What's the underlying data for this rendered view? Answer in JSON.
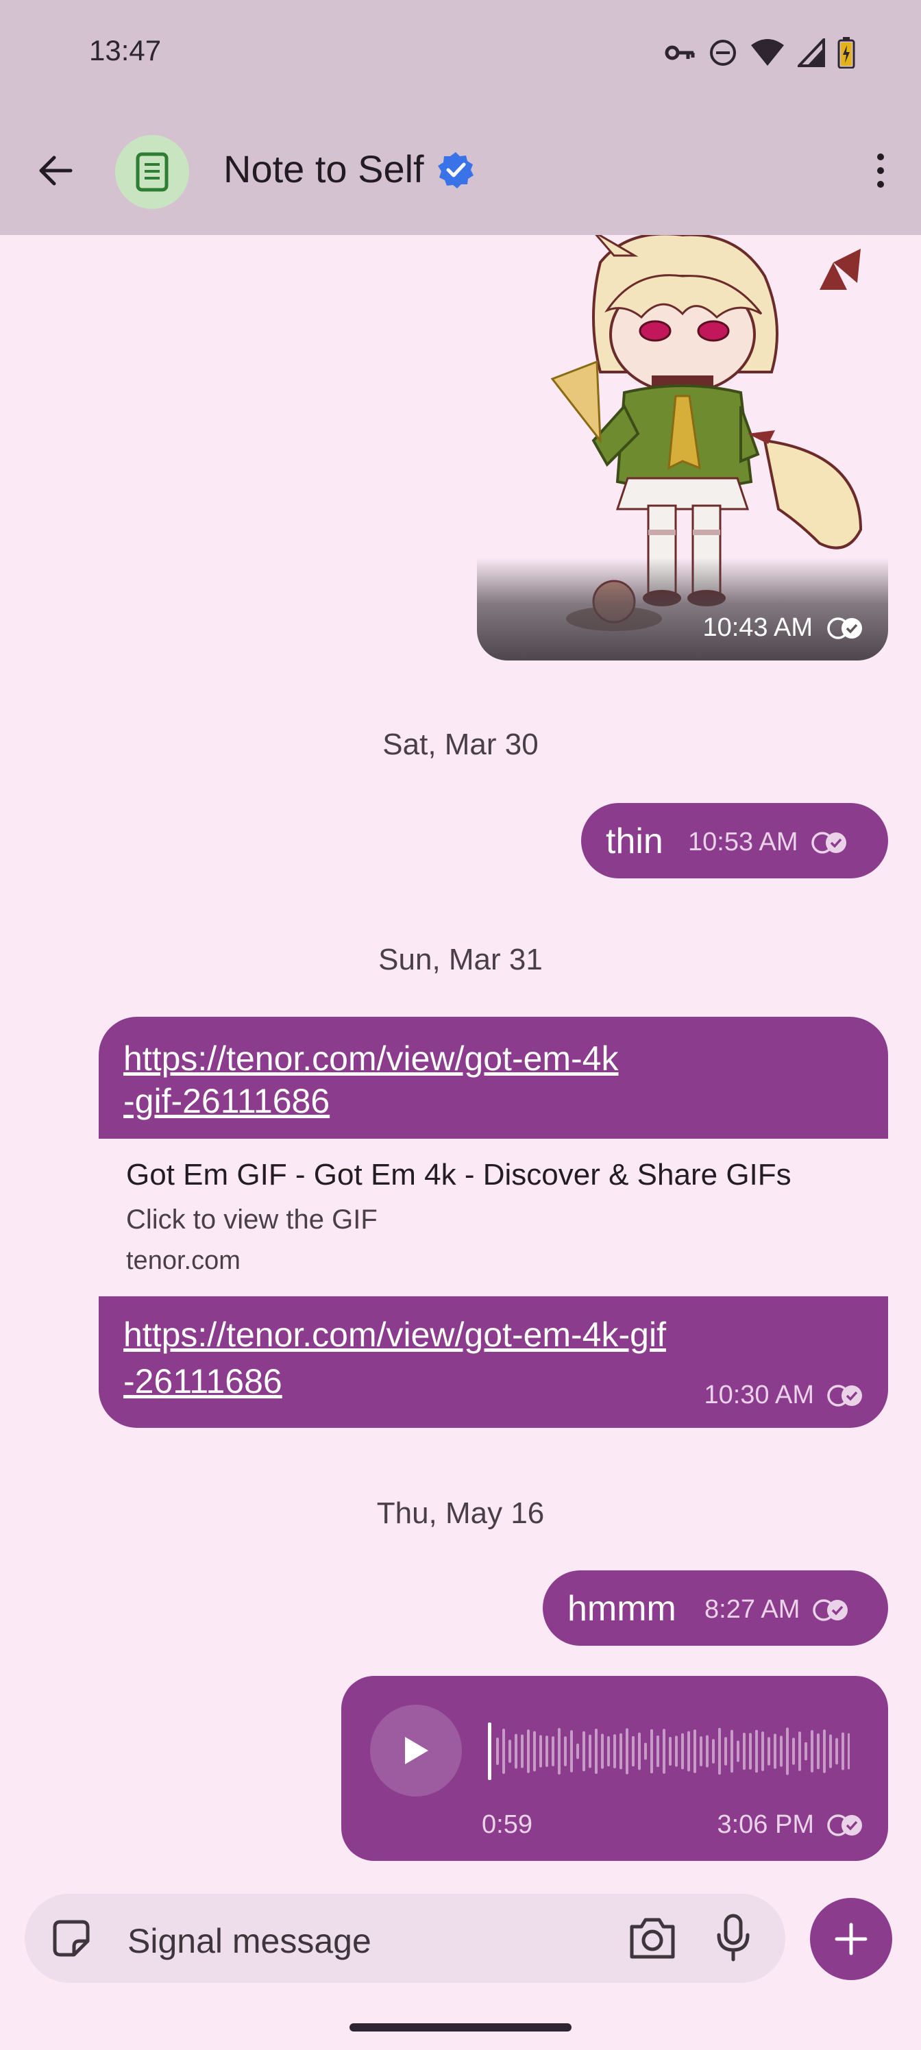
{
  "status_bar": {
    "time": "13:47",
    "icons": [
      "vpn-key-icon",
      "do-not-disturb-icon",
      "wifi-icon",
      "signal-icon",
      "battery-charging-icon"
    ]
  },
  "header": {
    "back_icon": "arrow-back-icon",
    "avatar_icon": "note-icon",
    "title": "Note to Self",
    "verified_icon": "verified-badge-icon",
    "more_icon": "more-vert-icon"
  },
  "messages": {
    "image": {
      "time": "10:43 AM",
      "status_icon": "delivered-read-icon"
    },
    "date_1": "Sat, Mar 30",
    "thin": {
      "text": "thin",
      "time": "10:53 AM"
    },
    "date_2": "Sun, Mar 31",
    "link": {
      "top_text": "https://tenor.com/view/got-em-4k-gif-26111686",
      "top_line1": "https://tenor.com/view/got-em-4k",
      "top_line2": "-gif-26111686",
      "preview_title": "Got Em GIF - Got Em 4k - Discover & Share GIFs",
      "preview_desc": "Click to view the GIF",
      "preview_domain": "tenor.com",
      "bottom_line1": "https://tenor.com/view/got-em-4k-gif",
      "bottom_line2": "-26111686",
      "time": "10:30 AM"
    },
    "date_3": "Thu, May 16",
    "hmmm": {
      "text": "hmmm",
      "time": "8:27 AM"
    },
    "voice": {
      "duration": "0:59",
      "time": "3:06 PM",
      "play_icon": "play-icon",
      "progress": 0
    }
  },
  "composer": {
    "sticker_icon": "sticker-icon",
    "placeholder": "Signal message",
    "camera_icon": "camera-icon",
    "mic_icon": "mic-icon",
    "add_icon": "plus-icon"
  },
  "colors": {
    "bubble": "#8B3C8D",
    "background": "#FBEAF5",
    "bars": "#D5C2D1",
    "verified": "#3A73E8"
  }
}
